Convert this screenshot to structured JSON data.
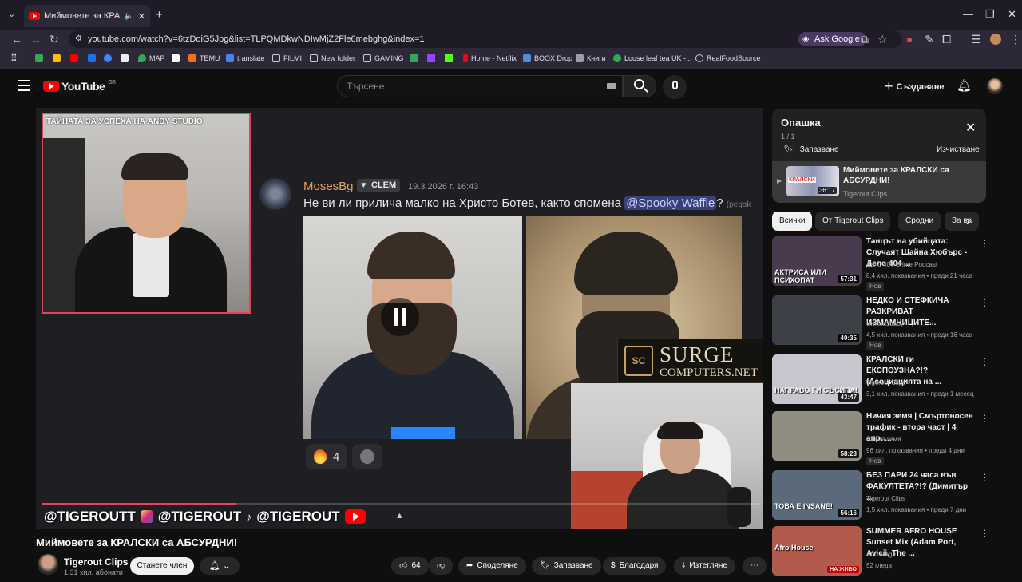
{
  "browser": {
    "tab_title": "Миймовете за КРАЛСКИ с",
    "url": "youtube.com/watch?v=6tzDoiG5Jpg&list=TLPQMDkwNDIwMjZ2Fle6mebghg&index=1",
    "ask_google": "Ask Google",
    "new_tab": "+",
    "bookmarks": [
      {
        "label": "MAP",
        "color": "#34a853"
      },
      {
        "label": "TEMU",
        "color": "#f36f21"
      },
      {
        "label": "translate",
        "color": "#4285f4"
      },
      {
        "label": "FILMI",
        "color": "#9aa0a6"
      },
      {
        "label": "New folder",
        "color": "#9aa0a6"
      },
      {
        "label": "GAMING",
        "color": "#9aa0a6"
      },
      {
        "label": "Home - Netflix",
        "color": "#e50914"
      },
      {
        "label": "BOOX Drop",
        "color": "#4a90e2"
      },
      {
        "label": "Книги",
        "color": "#9aa0a6"
      },
      {
        "label": "Loose leaf tea UK -...",
        "color": "#34a853"
      },
      {
        "label": "RealFoodSource",
        "color": "#9aa0a6"
      }
    ]
  },
  "header": {
    "logo_text": "YouTube",
    "logo_region": "GB",
    "search_placeholder": "Търсене",
    "create_label": "Създаване"
  },
  "player": {
    "cam_title": "ТАЙНАТА ЗА УСПЕХА НА ANDY STUDIO",
    "msg_user": "MosesBg",
    "msg_badge": "CLEM",
    "msg_time": "19.3.2026 г. 16:43",
    "msg_text": "Не ви ли прилича малко на Христо Ботев, както спомена ",
    "msg_mention": "@Spooky Waffle",
    "msg_after": "?",
    "msg_cut": "(pegak",
    "reaction_count": "4",
    "surge_line1": "SURGE",
    "surge_line2": "COMPUTERS.NET",
    "surge_logo": "SC",
    "social_1": "@TIGEROUTT",
    "social_2": "@TIGEROUT",
    "social_3": "@TIGEROUT",
    "progress_fraction": 0.27
  },
  "video": {
    "title": "Миймовете за КРАЛСКИ са АБСУРДНИ!",
    "channel": "Tigerout Clips",
    "subscribers": "1,31 хил. абонати",
    "join_label": "Станете член",
    "likes": "64",
    "share": "Споделяне",
    "save": "Запазване",
    "thanks": "Благодаря",
    "download": "Изтегляне"
  },
  "queue": {
    "title": "Опашка",
    "count": "1 / 1",
    "save": "Запазване",
    "clear": "Изчистване",
    "item_title": "Миймовете за КРАЛСКИ са АБСУРДНИ!",
    "item_channel": "Tigerout Clips",
    "item_duration": "36:17",
    "item_overlay": "КРАЛСКИ"
  },
  "chips": [
    "Всички",
    "От Tigerout Clips",
    "Сродни",
    "За ва"
  ],
  "recommendations": [
    {
      "title": "Танцът на убийцата: Случаят Шайна Хюбърс - Дело 404 ...",
      "channel": "Дело 404 Crime Podcast",
      "meta": "8,4 хил. показвания • преди 21 часа",
      "new": "Нов",
      "duration": "57:31",
      "overlay": "АКТРИСА ИЛИ ПСИХОПАТ",
      "bg": "#4a3a4e"
    },
    {
      "title": "НЕДКО И СТЕФКИЧА РАЗКРИВАТ ИЗМАМНИЦИТЕ...",
      "channel": "Unkind1baby",
      "meta": "4,5 хил. показвания • преди 16 часа",
      "new": "Нов",
      "duration": "40:35",
      "overlay": "",
      "bg": "#3d4046"
    },
    {
      "title": "КРАЛСКИ ги ЕКСПОУЗНА?!? (Асоциацията на ...",
      "channel": "Tigerout Clips",
      "meta": "3,1 хил. показвания • преди 1 месец",
      "new": "",
      "duration": "43:47",
      "overlay": "НАПРАВО ГИ СЪСИПА!",
      "bg": "#c9c5cf"
    },
    {
      "title": "Ничия земя | Смъртоносен трафик - втора част | 4 апр. ...",
      "channel": "Ничия земя",
      "meta": "96 хил. показвания • преди 4 дни",
      "new": "Нов",
      "duration": "58:23",
      "overlay": "",
      "bg": "#8f8c80"
    },
    {
      "title": "БЕЗ ПАРИ 24 часа във ФАКУЛТЕТА?!? (Димитър ...",
      "channel": "Tigerout Clips",
      "meta": "1,5 хил. показвания • преди 7 дни",
      "new": "",
      "duration": "56:16",
      "overlay": "ТОВА Е INSANE!",
      "bg": "#5a6a7a"
    },
    {
      "title": "SUMMER AFRO HOUSE Sunset Mix (Adam Port, Avicii, The ...",
      "channel": "Afro Mage",
      "meta": "52 гледат",
      "new": "",
      "duration": "НА ЖИВО",
      "overlay": "Afro House",
      "bg": "#b35a4e"
    }
  ]
}
